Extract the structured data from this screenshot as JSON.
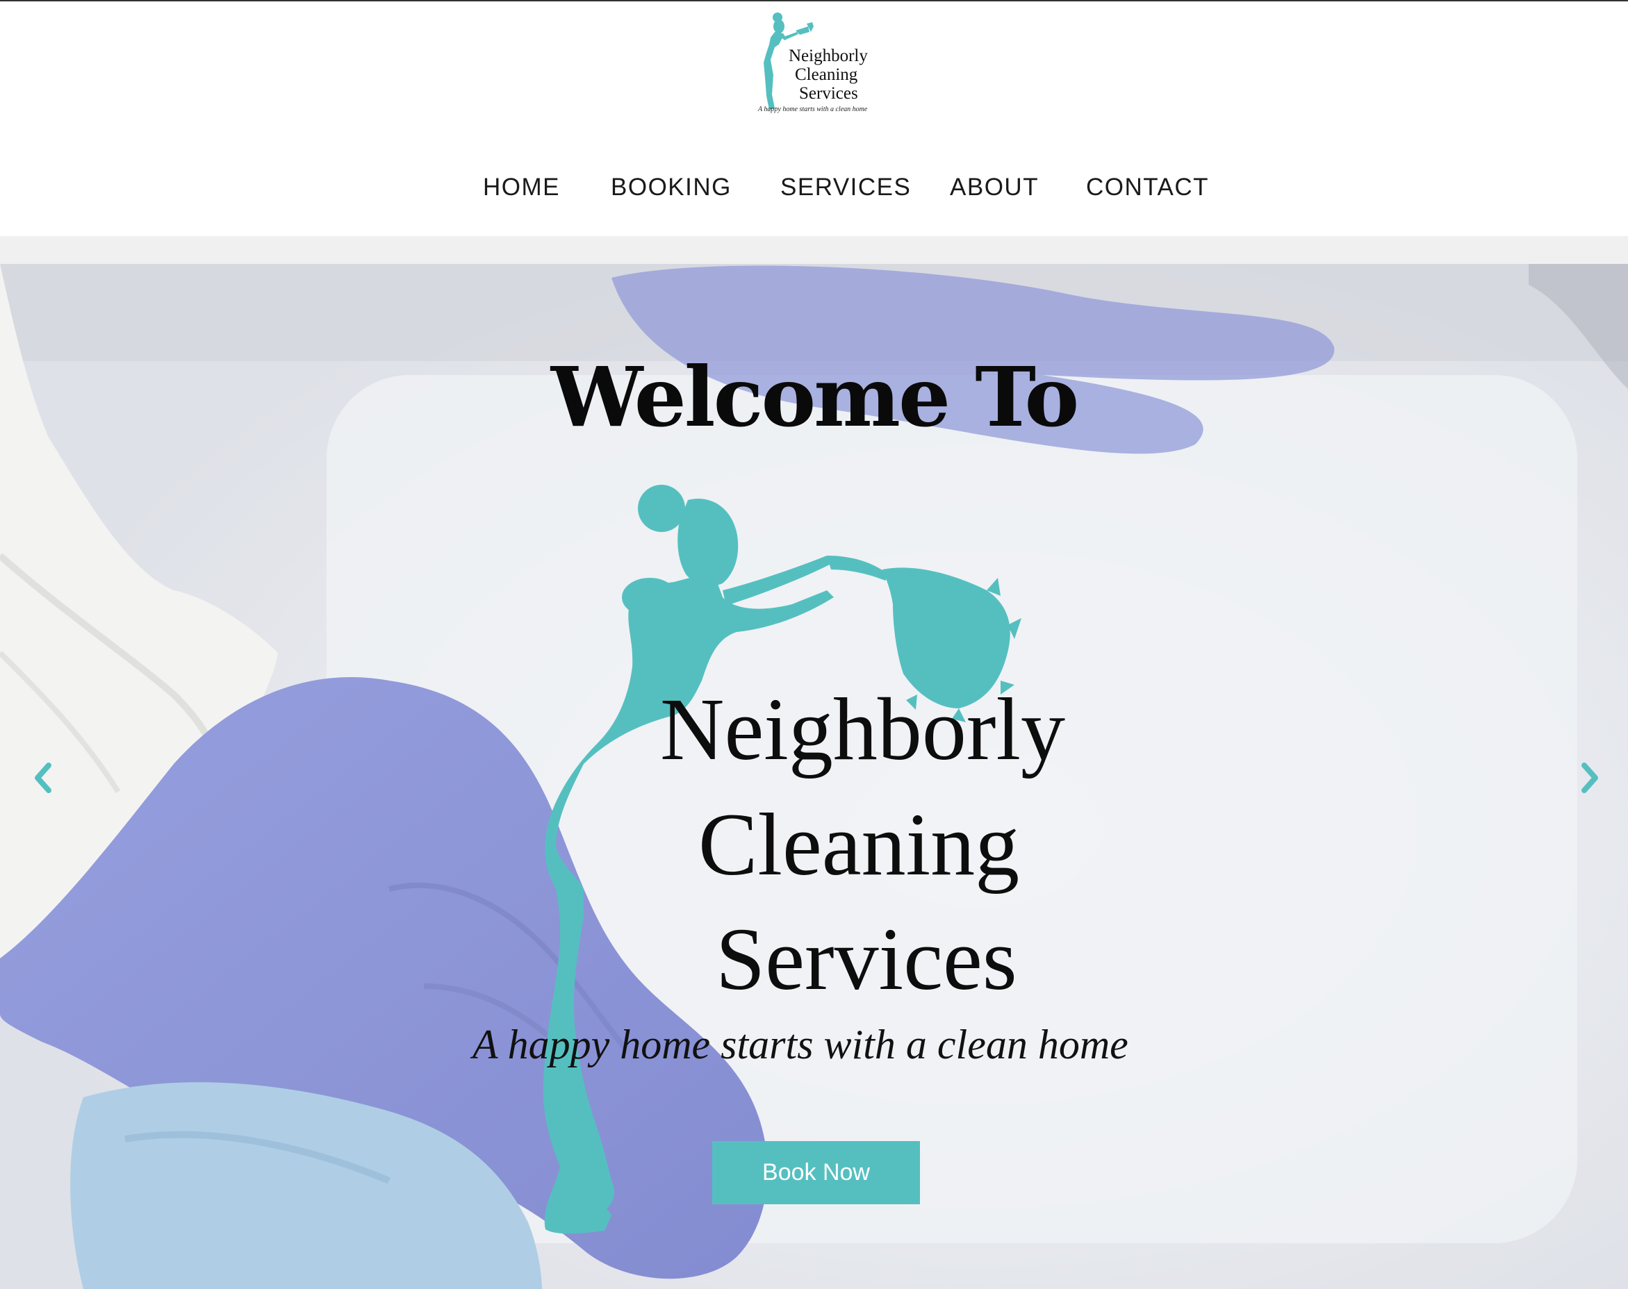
{
  "brand": {
    "name_line1": "Neighborly",
    "name_line2": "Cleaning",
    "name_line3": "Services",
    "tagline": "A happy home starts with a clean home",
    "logo_icon": "maid-dusting-silhouette-icon",
    "accent_color": "#55bfc0"
  },
  "nav": {
    "items": [
      {
        "label": "HOME"
      },
      {
        "label": "BOOKING"
      },
      {
        "label": "SERVICES"
      },
      {
        "label": "ABOUT"
      },
      {
        "label": "CONTACT"
      }
    ]
  },
  "hero": {
    "heading": "Welcome To",
    "cta_label": "Book Now",
    "prev_icon": "chevron-left-icon",
    "next_icon": "chevron-right-icon"
  }
}
